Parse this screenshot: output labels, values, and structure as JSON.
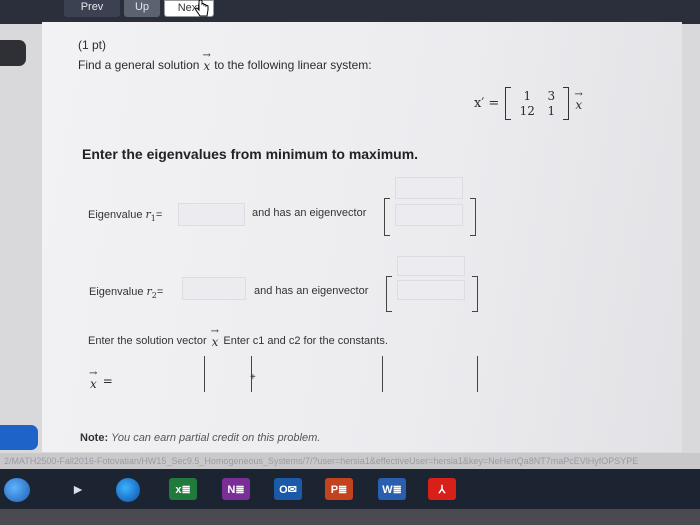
{
  "nav": {
    "prev": "Prev",
    "up": "Up",
    "next": "Next"
  },
  "problem": {
    "points": "(1 pt)",
    "prompt_before": "Find a general solution",
    "prompt_after": "to the following linear system:",
    "vector_symbol": "x",
    "vector_prime": "x′ =",
    "matrix": [
      [
        "1",
        "3"
      ],
      [
        "12",
        "1"
      ]
    ],
    "heading": "Enter the eigenvalues from minimum to maximum.",
    "eigen1": {
      "label": "Eigenvalue",
      "symbol": "r",
      "index": "1",
      "eq": "=",
      "vector_label": "and has an eigenvector"
    },
    "eigen2": {
      "label": "Eigenvalue",
      "symbol": "r",
      "index": "2",
      "eq": "=",
      "vector_label": "and has an eigenvector"
    },
    "solution_before": "Enter the solution vector",
    "solution_after": "Enter c1 and c2 for the constants.",
    "solution_eq": "=",
    "plus": "+",
    "note_label": "Note:",
    "note_text": "You can earn partial credit on this problem."
  },
  "url": "2/MATH2500-Fall2016-Fotovatian/HW15_Sec9.5_Homogeneous_Systems/7/?user=hersia1&effectiveUser=hersia1&key=NeHertQa8NT7maPcEVlHyfOPSYPE",
  "taskbar": {
    "icons": [
      "windows-start",
      "media-player",
      "firefox",
      "excel",
      "onenote",
      "outlook",
      "powerpoint",
      "word",
      "acrobat"
    ],
    "excel": "x≣",
    "onenote": "N≣",
    "outlook": "O✉",
    "ppt": "P≣",
    "word": "W≣",
    "acrobat": "⅄"
  }
}
